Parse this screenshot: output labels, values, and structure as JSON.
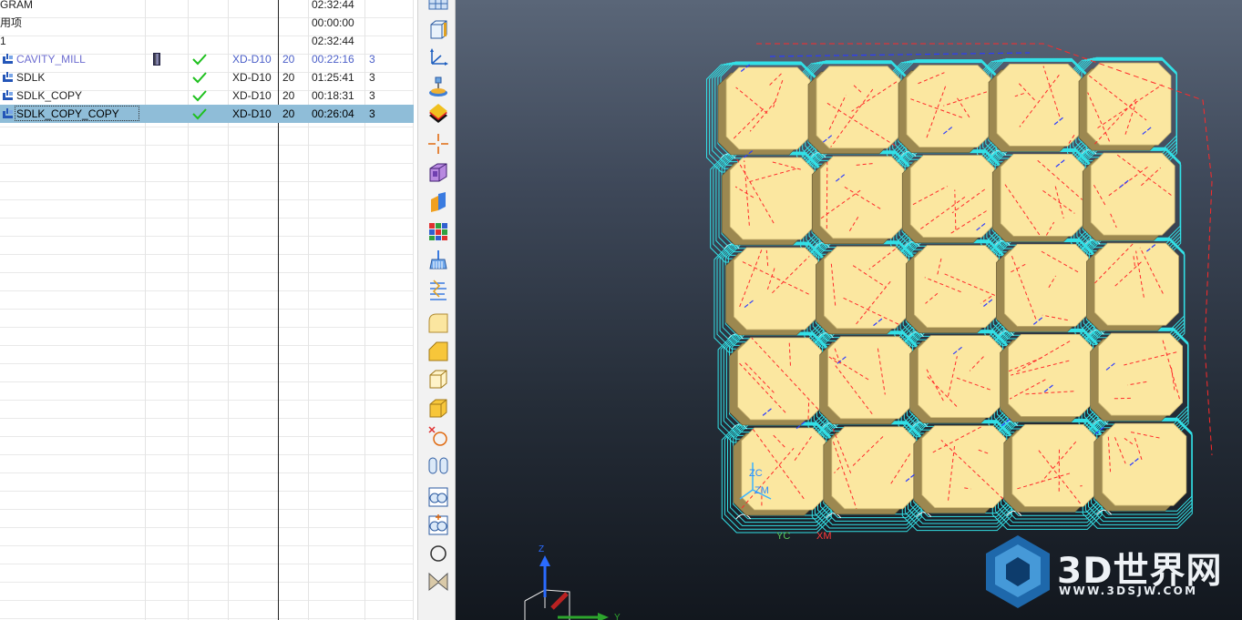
{
  "navigator": {
    "rows": [
      {
        "name": "GRAM",
        "tool": "",
        "num": "",
        "time": "02:32:44",
        "group": "",
        "kind": "program",
        "checked": false,
        "path": false,
        "selected": false
      },
      {
        "name": "用项",
        "tool": "",
        "num": "",
        "time": "00:00:00",
        "group": "",
        "kind": "program",
        "checked": false,
        "path": false,
        "selected": false
      },
      {
        "name": "1",
        "tool": "",
        "num": "",
        "time": "02:32:44",
        "group": "",
        "kind": "program",
        "checked": false,
        "path": false,
        "selected": false
      },
      {
        "name": "CAVITY_MILL",
        "tool": "XD-D10",
        "num": "20",
        "time": "00:22:16",
        "group": "3",
        "kind": "operation",
        "checked": true,
        "path": true,
        "selected": false
      },
      {
        "name": "SDLK",
        "tool": "XD-D10",
        "num": "20",
        "time": "01:25:41",
        "group": "3",
        "kind": "operation",
        "checked": true,
        "path": false,
        "selected": false
      },
      {
        "name": "SDLK_COPY",
        "tool": "XD-D10",
        "num": "20",
        "time": "00:18:31",
        "group": "3",
        "kind": "operation",
        "checked": true,
        "path": false,
        "selected": false
      },
      {
        "name": "SDLK_COPY_COPY",
        "tool": "XD-D10",
        "num": "20",
        "time": "00:26:04",
        "group": "3",
        "kind": "operation",
        "checked": true,
        "path": false,
        "selected": true
      }
    ]
  },
  "toolbar": {
    "icons": [
      "table-icon",
      "block-3d-icon",
      "coordinate-system-icon",
      "machine-tool-icon",
      "layers-icon",
      "crosshair-icon",
      "view-cube-icon",
      "section-icon",
      "color-grid-icon",
      "broom-icon",
      "stack-icon",
      "rounded-corner-icon",
      "chamfer-corner-icon",
      "box-outline-icon",
      "box-solid-icon",
      "point-on-circle-icon",
      "cylinder-pair-icon",
      "face-pair-icon",
      "face-pair-plus-icon",
      "circle-icon",
      "bowtie-icon"
    ]
  },
  "viewport": {
    "colors": {
      "part": "#fbe7a0",
      "part_side": "#9c8850",
      "toolpath": "#33e0e6",
      "rapid": "#ff2a2a",
      "engage": "#2c3cff",
      "retract": "#ffffff"
    },
    "axis_labels": {
      "z": "Z",
      "y": "Y",
      "zc": "ZC",
      "zm": "ZM",
      "yc": "YC",
      "xm": "XM"
    },
    "watermark": {
      "title": "3D世界网",
      "url": "WWW.3DSJW.COM"
    }
  }
}
